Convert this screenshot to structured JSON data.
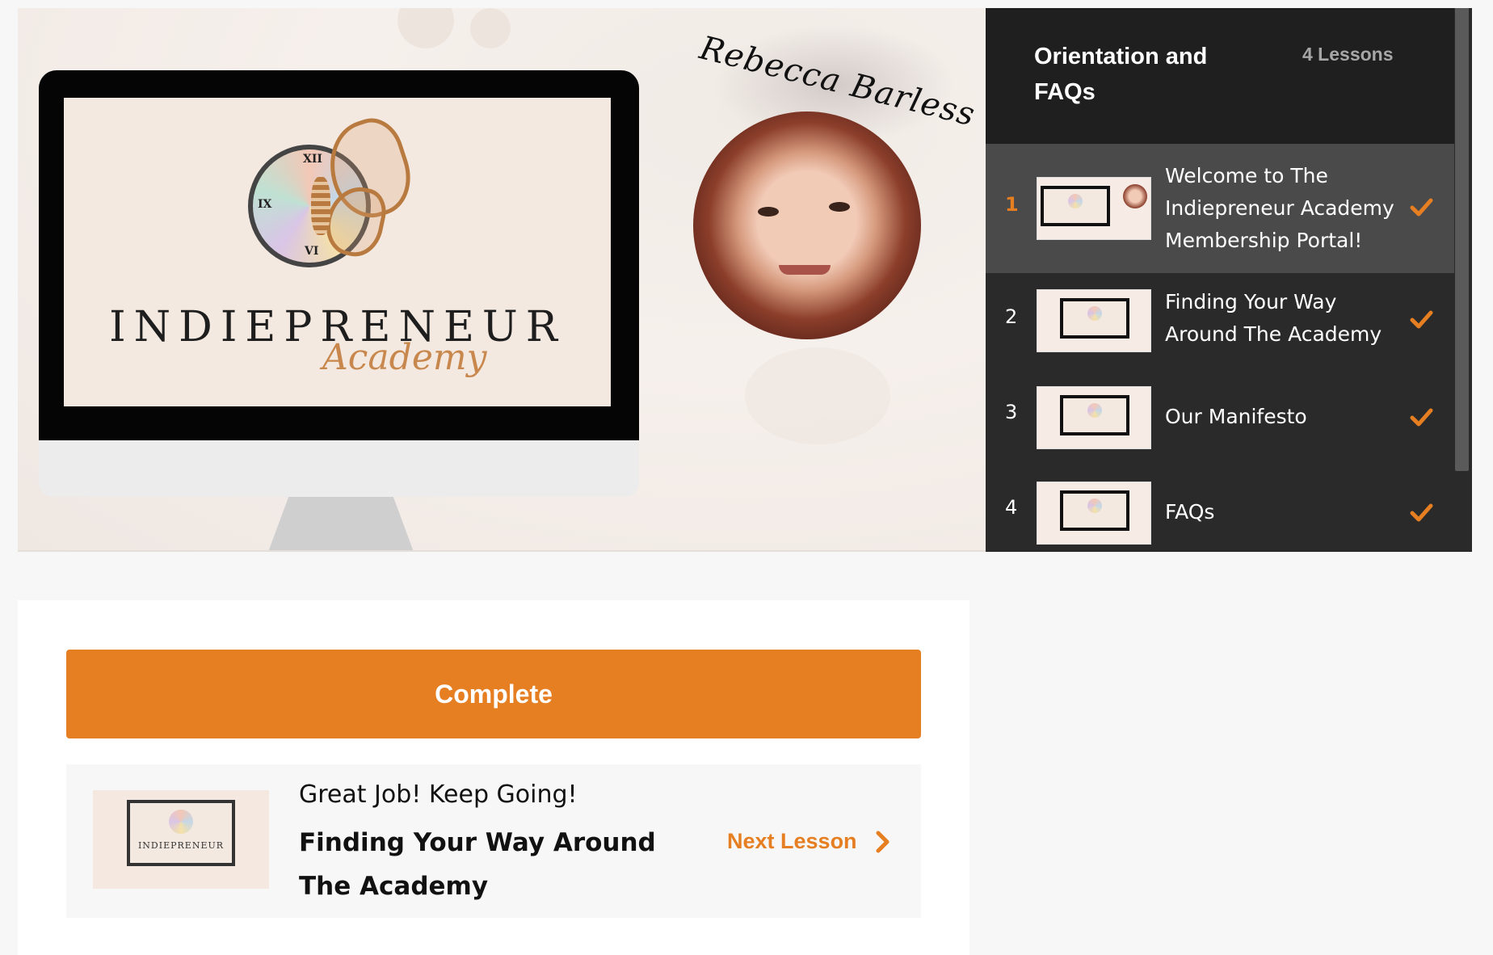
{
  "hero": {
    "brand_text": "INDIEPRENEUR",
    "brand_script": "Academy",
    "signature": "Rebecca Barless"
  },
  "playlist": {
    "title": "Orientation and FAQs",
    "count": "4 Lessons",
    "lessons": [
      {
        "number": "1",
        "title": "Welcome to The Indiepreneur Academy Membership Portal!",
        "completed": true,
        "active": true
      },
      {
        "number": "2",
        "title": "Finding Your Way Around The Academy",
        "completed": true,
        "active": false
      },
      {
        "number": "3",
        "title": "Our Manifesto",
        "completed": true,
        "active": false
      },
      {
        "number": "4",
        "title": "FAQs",
        "completed": true,
        "active": false
      }
    ]
  },
  "content": {
    "complete_label": "Complete",
    "next": {
      "kicker": "Great Job! Keep Going!",
      "title": "Finding Your Way Around The Academy",
      "link_label": "Next Lesson",
      "thumb_text": "INDIEPRENEUR"
    }
  },
  "colors": {
    "accent": "#e67e22",
    "sidebar_bg": "#2a2a2a",
    "active_row": "#4a4a4a"
  },
  "icons": {
    "check": "check-icon",
    "next": "chevron-right-icon"
  }
}
